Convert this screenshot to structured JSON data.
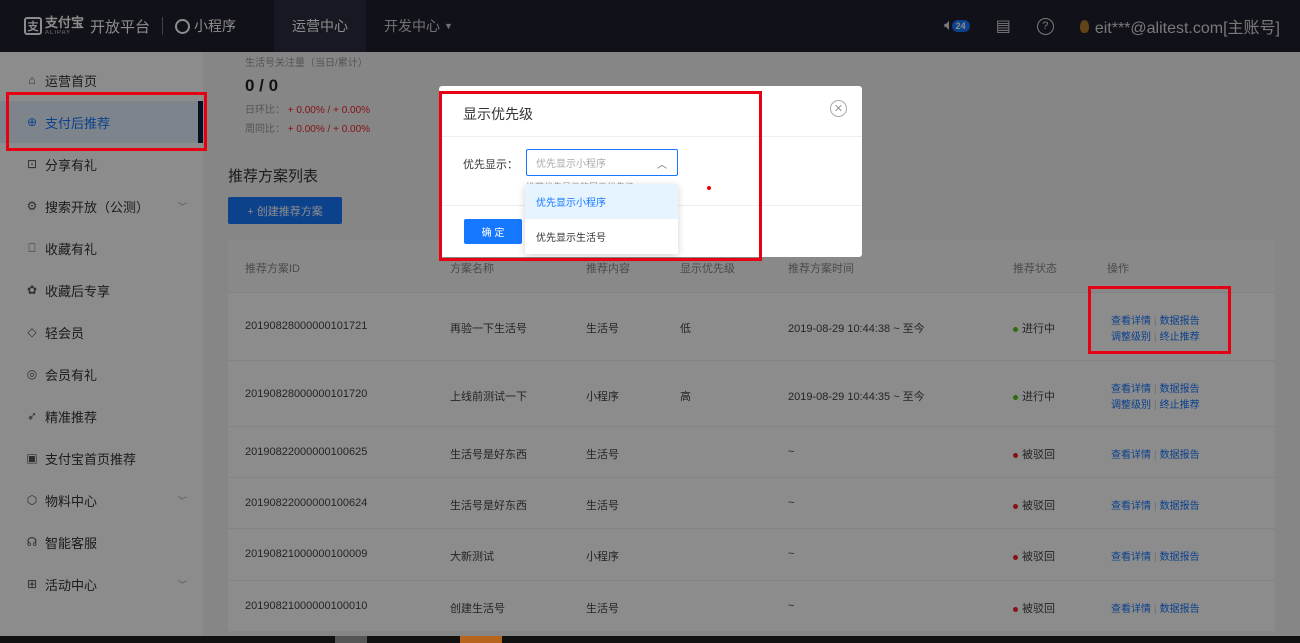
{
  "header": {
    "brand_logo": "支付宝",
    "brand_sub": "ALIPAY",
    "platform": "开放平台",
    "mini_program": "小程序",
    "nav": [
      {
        "label": "运营中心",
        "active": true
      },
      {
        "label": "开发中心",
        "active": false
      }
    ],
    "notification_count": "24",
    "help": "?",
    "account": "eit***@alitest.com[主账号]"
  },
  "sidebar": {
    "items": [
      {
        "label": "运营首页",
        "icon": "home-icon"
      },
      {
        "label": "支付后推荐",
        "icon": "add-circle-icon",
        "active": true
      },
      {
        "label": "分享有礼",
        "icon": "share-icon"
      },
      {
        "label": "搜索开放（公测）",
        "icon": "search-icon",
        "expandable": true
      },
      {
        "label": "收藏有礼",
        "icon": "bookmark-icon"
      },
      {
        "label": "收藏后专享",
        "icon": "gift-icon"
      },
      {
        "label": "轻会员",
        "icon": "diamond-icon"
      },
      {
        "label": "会员有礼",
        "icon": "member-icon"
      },
      {
        "label": "精准推荐",
        "icon": "send-icon"
      },
      {
        "label": "支付宝首页推荐",
        "icon": "doc-icon"
      },
      {
        "label": "物料中心",
        "icon": "box-icon",
        "expandable": true
      },
      {
        "label": "智能客服",
        "icon": "headset-icon"
      },
      {
        "label": "活动中心",
        "icon": "gift-box-icon",
        "expandable": true
      }
    ]
  },
  "metrics": {
    "label": "生活号关注量（当日/累计）",
    "value": "0 / 0",
    "day_label": "日环比：",
    "day_value": "+ 0.00% / + 0.00%",
    "week_label": "周同比：",
    "week_value": "+ 0.00% / + 0.00%"
  },
  "list": {
    "title": "推荐方案列表",
    "create_button": "+ 创建推荐方案",
    "columns": [
      "推荐方案ID",
      "方案名称",
      "推荐内容",
      "显示优先级",
      "推荐方案时间",
      "推荐状态",
      "操作"
    ],
    "rows": [
      {
        "id": "20190828000000101721",
        "name": "再验一下生活号",
        "content": "生活号",
        "priority": "低",
        "time": "2019-08-29 10:44:38 ~ 至今",
        "status": "进行中",
        "status_color": "#52c41a",
        "ops": [
          "查看详情",
          "数据报告",
          "调整级别",
          "终止推荐"
        ]
      },
      {
        "id": "20190828000000101720",
        "name": "上线前测试一下",
        "content": "小程序",
        "priority": "高",
        "time": "2019-08-29 10:44:35 ~ 至今",
        "status": "进行中",
        "status_color": "#52c41a",
        "ops": [
          "查看详情",
          "数据报告",
          "调整级别",
          "终止推荐"
        ]
      },
      {
        "id": "20190822000000100625",
        "name": "生活号是好东西",
        "content": "生活号",
        "priority": "",
        "time": "~",
        "status": "被驳回",
        "status_color": "#f5222d",
        "ops": [
          "查看详情",
          "数据报告"
        ]
      },
      {
        "id": "20190822000000100624",
        "name": "生活号是好东西",
        "content": "生活号",
        "priority": "",
        "time": "~",
        "status": "被驳回",
        "status_color": "#f5222d",
        "ops": [
          "查看详情",
          "数据报告"
        ]
      },
      {
        "id": "20190821000000100009",
        "name": "大新测试",
        "content": "小程序",
        "priority": "",
        "time": "~",
        "status": "被驳回",
        "status_color": "#f5222d",
        "ops": [
          "查看详情",
          "数据报告"
        ]
      },
      {
        "id": "20190821000000100010",
        "name": "创建生活号",
        "content": "生活号",
        "priority": "",
        "time": "~",
        "status": "被驳回",
        "status_color": "#f5222d",
        "ops": [
          "查看详情",
          "数据报告"
        ]
      }
    ]
  },
  "modal": {
    "title": "显示优先级",
    "field_label": "优先显示：",
    "select_placeholder": "优先显示小程序",
    "hint": "推荐优先显示的展示优先级",
    "confirm": "确 定",
    "options": [
      "优先显示小程序",
      "优先显示生活号"
    ]
  },
  "colors": {
    "accent": "#1677ff",
    "topbar": "#1f1f2e",
    "highlight": "#e60012"
  }
}
